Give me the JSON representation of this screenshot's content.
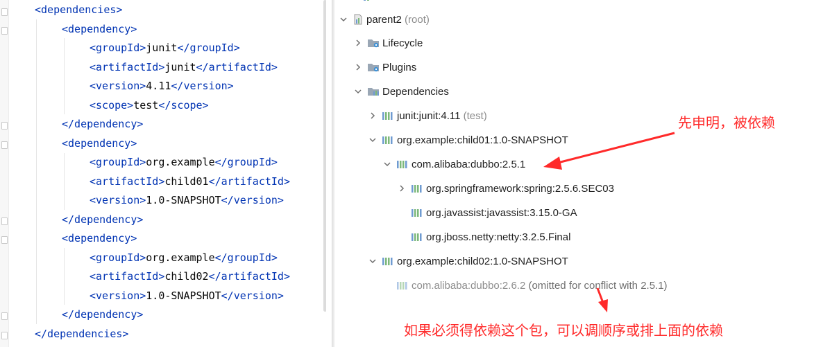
{
  "editor": {
    "lines": [
      {
        "indent": 0,
        "open": "<dependencies>"
      },
      {
        "indent": 1,
        "open": "<dependency>"
      },
      {
        "indent": 2,
        "open": "<groupId>",
        "value": "junit",
        "close": "</groupId>"
      },
      {
        "indent": 2,
        "open": "<artifactId>",
        "value": "junit",
        "close": "</artifactId>"
      },
      {
        "indent": 2,
        "open": "<version>",
        "value": "4.11",
        "close": "</version>"
      },
      {
        "indent": 2,
        "open": "<scope>",
        "value": "test",
        "close": "</scope>"
      },
      {
        "indent": 1,
        "open": "</dependency>"
      },
      {
        "indent": 1,
        "open": "<dependency>"
      },
      {
        "indent": 2,
        "open": "<groupId>",
        "value": "org.example",
        "close": "</groupId>"
      },
      {
        "indent": 2,
        "open": "<artifactId>",
        "value": "child01",
        "close": "</artifactId>"
      },
      {
        "indent": 2,
        "open": "<version>",
        "value": "1.0-SNAPSHOT",
        "close": "</version>"
      },
      {
        "indent": 1,
        "open": "</dependency>"
      },
      {
        "indent": 1,
        "open": "<dependency>"
      },
      {
        "indent": 2,
        "open": "<groupId>",
        "value": "org.example",
        "close": "</groupId>"
      },
      {
        "indent": 2,
        "open": "<artifactId>",
        "value": "child02",
        "close": "</artifactId>"
      },
      {
        "indent": 2,
        "open": "<version>",
        "value": "1.0-SNAPSHOT",
        "close": "</version>"
      },
      {
        "indent": 1,
        "open": "</dependency>"
      },
      {
        "indent": 0,
        "open": "</dependencies>"
      }
    ]
  },
  "tree": {
    "root": {
      "label": "parent2",
      "suffix": "(root)"
    },
    "lifecycle": "Lifecycle",
    "plugins": "Plugins",
    "dependencies": "Dependencies",
    "junit": {
      "label": "junit:junit:4.11",
      "suffix": "(test)"
    },
    "child01": "org.example:child01:1.0-SNAPSHOT",
    "dubbo251": "com.alibaba:dubbo:2.5.1",
    "spring": "org.springframework:spring:2.5.6.SEC03",
    "javassist": "org.javassist:javassist:3.15.0-GA",
    "netty": "org.jboss.netty:netty:3.2.5.Final",
    "child02": "org.example:child02:1.0-SNAPSHOT",
    "dubbo262": {
      "label": "com.alibaba:dubbo:2.6.2",
      "note": "(omitted for conflict with 2.5.1)"
    }
  },
  "annotations": {
    "first_declared": "先申明，被依赖",
    "reorder_hint": "如果必须得依赖这个包，可以调顺序或排上面的依赖"
  },
  "colors": {
    "tag": "#0033b3",
    "annotation": "#ff2a2a",
    "muted_text": "#8c8c8c",
    "bar_blue": "#6f9bd1",
    "bar_green": "#7cb87a"
  }
}
